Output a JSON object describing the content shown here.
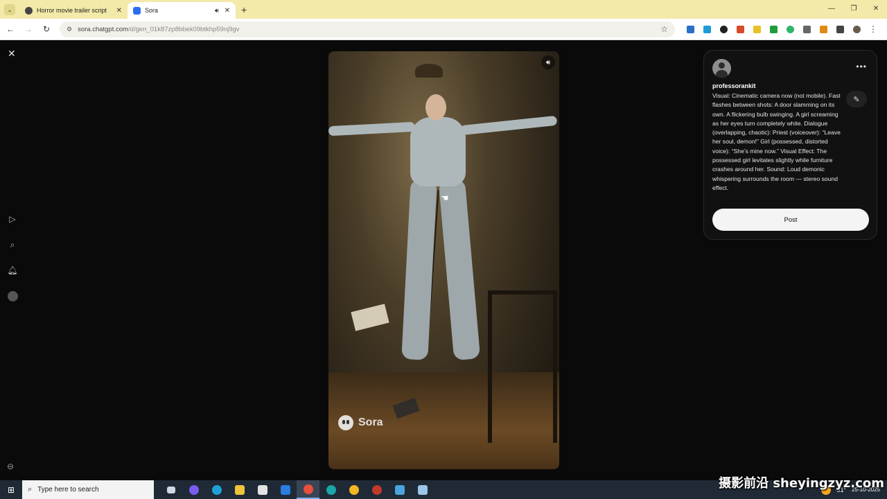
{
  "browser": {
    "tabs": [
      {
        "title": "Horror movie trailer script",
        "active": false,
        "audio": false
      },
      {
        "title": "Sora",
        "active": true,
        "audio": true
      }
    ],
    "url_host": "sora.chatgpt.com",
    "url_path": "/d/gen_01k87zp8bbek09btkhp59nj9gv",
    "extensions": [
      "extension-1",
      "extension-2",
      "extension-3",
      "extension-4",
      "extension-5",
      "extension-6",
      "extension-7",
      "extension-8"
    ]
  },
  "page": {
    "icons": [
      "close-icon",
      "play-icon",
      "search-icon",
      "bell-icon",
      "profile-icon",
      "more-icon"
    ]
  },
  "video": {
    "watermark": "Sora"
  },
  "panel": {
    "username": "professorankit",
    "prompt": "Visual: Cinematic camera now (not mobile). Fast flashes between shots: A door slamming on its own. A flickering bulb swinging. A girl screaming as her eyes turn completely white. Dialogue (overlapping, chaotic): Priest (voiceover): “Leave her soul, demon!” Girl (possessed, distorted voice): “She’s mine now.” Visual Effect: The possessed girl levitates slightly while furniture crashes around her. Sound: Loud demonic whispering surrounds the room — stereo sound effect.",
    "post_label": "Post"
  },
  "taskbar": {
    "search_placeholder": "Type here to search",
    "temperature": "31°",
    "date": "25-10-2025"
  },
  "overlay": {
    "brand": "摄影前沿 sheyingzyz.com"
  },
  "colors": {
    "tabbar": "#f3e9a8",
    "page_bg": "#0a0a0a",
    "panel_bg": "#111111",
    "post_button": "#f4f4f4",
    "taskbar": "#1f2a36"
  }
}
